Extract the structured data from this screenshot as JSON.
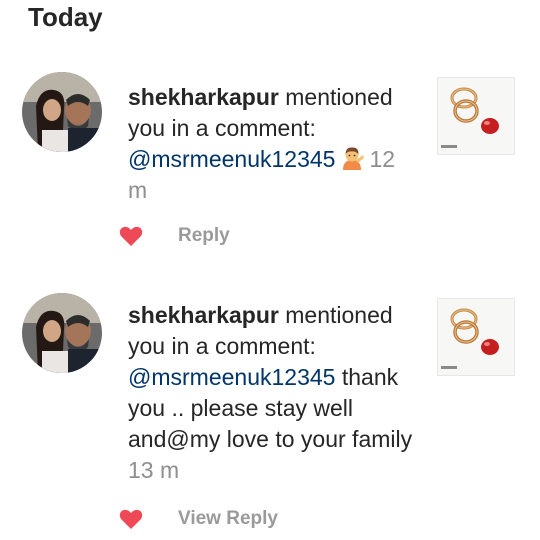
{
  "header": {
    "title": "Today"
  },
  "notifications": [
    {
      "username": "shekharkapur",
      "action_text": " mentioned you in a comment: ",
      "mention": "@msrmeenuk12345",
      "comment_after": "",
      "emoji": "person-tipping-hand-emoji",
      "time": "12 m",
      "reply_label": "Reply",
      "liked": true
    },
    {
      "username": "shekharkapur",
      "action_text": " mentioned you in a comment: ",
      "mention": "@msrmeenuk12345",
      "comment_after": " thank you .. please stay well and@my love to your family",
      "emoji": "",
      "time": "13 m",
      "reply_label": "View Reply",
      "liked": true
    }
  ],
  "colors": {
    "heart": "#ed4956",
    "mention": "#003569",
    "muted": "#8e8e8e",
    "text": "#262626"
  },
  "icons": {
    "like": "heart-icon",
    "post_thumbnail": "rings-and-heart-thumbnail"
  }
}
